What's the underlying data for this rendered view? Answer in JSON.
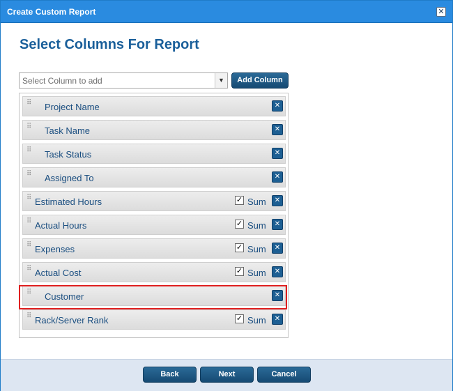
{
  "window": {
    "title": "Create Custom Report",
    "close_symbol": "✕"
  },
  "heading": "Select Columns For Report",
  "column_picker": {
    "value": "Select Column to add",
    "arrow": "▼",
    "add_button": "Add Column"
  },
  "columns": [
    {
      "label": "Project Name",
      "sum": false
    },
    {
      "label": "Task Name",
      "sum": false
    },
    {
      "label": "Task Status",
      "sum": false
    },
    {
      "label": "Assigned To",
      "sum": false
    },
    {
      "label": "Estimated Hours",
      "sum": true,
      "sum_label": "Sum",
      "checked": true
    },
    {
      "label": "Actual Hours",
      "sum": true,
      "sum_label": "Sum",
      "checked": true
    },
    {
      "label": "Expenses",
      "sum": true,
      "sum_label": "Sum",
      "checked": true
    },
    {
      "label": "Actual Cost",
      "sum": true,
      "sum_label": "Sum",
      "checked": true
    },
    {
      "label": "Customer",
      "sum": false,
      "highlighted": true
    },
    {
      "label": "Rack/Server Rank",
      "sum": true,
      "sum_label": "Sum",
      "checked": true
    }
  ],
  "symbols": {
    "check": "✓",
    "remove": "✕",
    "grip": "⠿"
  },
  "footer": {
    "back": "Back",
    "next": "Next",
    "cancel": "Cancel"
  },
  "colors": {
    "titlebar": "#2a8be0",
    "heading": "#1a5f9a",
    "button": "#1d5f93",
    "highlight": "#e02020",
    "footer": "#dde6f2"
  }
}
